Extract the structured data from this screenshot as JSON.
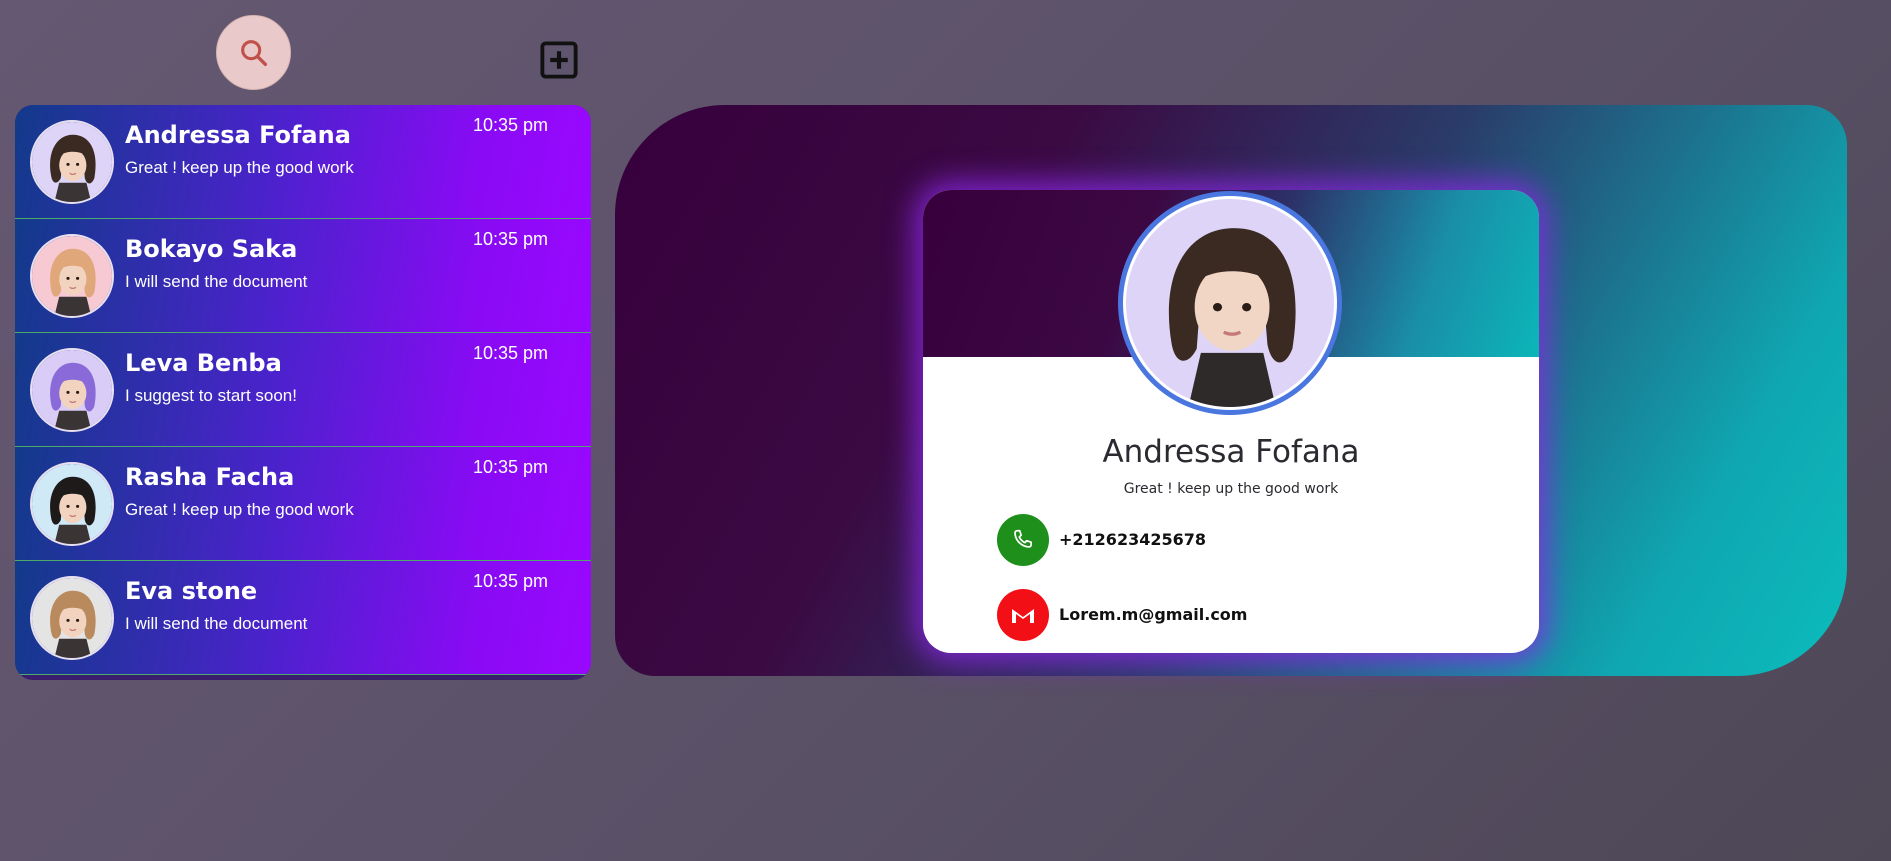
{
  "toolbar": {
    "search_icon": "search-icon",
    "add_icon": "plus-square-icon"
  },
  "contacts": [
    {
      "name": "Andressa Fofana",
      "message": "Great ! keep up the good work",
      "time": "10:35 pm",
      "avatar_bg": "#ded4f7",
      "hair": "#3a2a22"
    },
    {
      "name": "Bokayo Saka",
      "message": "I will send the document",
      "time": "10:35 pm",
      "avatar_bg": "#f7c9d3",
      "hair": "#e0a87a"
    },
    {
      "name": "Leva Benba",
      "message": "I suggest to start soon!",
      "time": "10:35 pm",
      "avatar_bg": "#d9cdf7",
      "hair": "#8a6ad8"
    },
    {
      "name": "Rasha Facha",
      "message": "Great ! keep up the good work",
      "time": "10:35 pm",
      "avatar_bg": "#cfe9f7",
      "hair": "#1e1a1a"
    },
    {
      "name": "Eva stone",
      "message": "I will send the document",
      "time": "10:35 pm",
      "avatar_bg": "#e4e4e4",
      "hair": "#b88a5e"
    }
  ],
  "profile": {
    "name": "Andressa Fofana",
    "status": "Great ! keep up the good work",
    "phone": "+212623425678",
    "email": "Lorem.m@gmail.com",
    "phone_icon_color": "#1f8f1b",
    "email_icon_color": "#f20f16"
  },
  "colors": {
    "accent_purple": "#8a0af5",
    "panel_teal": "#0bbcbc",
    "panel_plum": "#36003c",
    "avatar_ring": "#4a76e0"
  }
}
